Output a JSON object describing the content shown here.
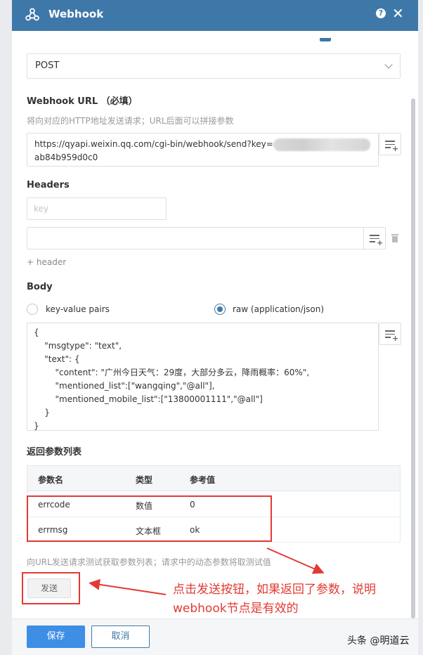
{
  "dialog": {
    "title": "Webhook",
    "help_label": "?",
    "close_label": "✕"
  },
  "method": {
    "value": "POST"
  },
  "webhook_url": {
    "label": "Webhook URL",
    "required_tag": "（必填）",
    "hint": "将向对应的HTTP地址发送请求；URL后面可以拼接参数",
    "value_prefix": "https://qyapi.weixin.qq.com/cgi-bin/webhook/send?key=",
    "value_suffix": "ab84b959d0c0"
  },
  "headers": {
    "label": "Headers",
    "key_placeholder": "key",
    "add_label": "+ header"
  },
  "body": {
    "label": "Body",
    "option_kv": "key-value pairs",
    "option_raw": "raw (application/json)",
    "selected": "raw",
    "content": "{\n    \"msgtype\": \"text\",\n    \"text\": {\n        \"content\": \"广州今日天气：29度，大部分多云，降雨概率：60%\",\n        \"mentioned_list\":[\"wangqing\",\"@all\"],\n        \"mentioned_mobile_list\":[\"13800001111\",\"@all\"]\n    }\n}"
  },
  "return_params": {
    "label": "返回参数列表",
    "columns": [
      "参数名",
      "类型",
      "参考值"
    ],
    "rows": [
      [
        "errcode",
        "数值",
        "0"
      ],
      [
        "errmsg",
        "文本框",
        "ok"
      ]
    ],
    "hint": "向URL发送请求测试获取参数列表；请求中的动态参数将取测试值",
    "send_label": "发送"
  },
  "footer": {
    "save_label": "保存",
    "cancel_label": "取消"
  },
  "annotation": {
    "text": "点击发送按钮，如果返回了参数，说明webhook节点是有效的",
    "color": "#e23a33"
  },
  "watermark": "头条 @明道云",
  "colors": {
    "header": "#3e78a8",
    "primary": "#3e8ee6"
  }
}
